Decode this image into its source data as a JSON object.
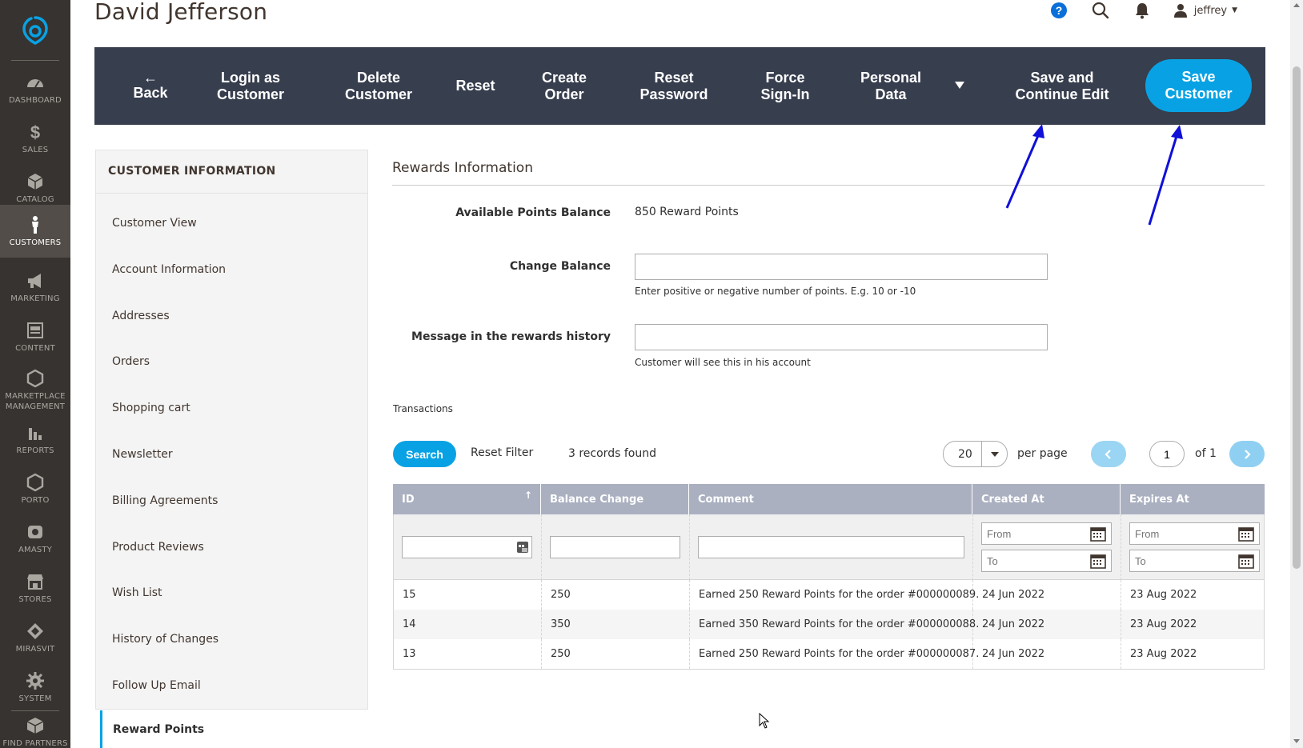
{
  "nav": {
    "items": [
      {
        "label": "DASHBOARD",
        "icon": "dashboard-icon"
      },
      {
        "label": "SALES",
        "icon": "dollar-icon"
      },
      {
        "label": "CATALOG",
        "icon": "cube-icon"
      },
      {
        "label": "CUSTOMERS",
        "icon": "person-icon",
        "active": true
      },
      {
        "label": "MARKETING",
        "icon": "megaphone-icon"
      },
      {
        "label": "CONTENT",
        "icon": "content-icon"
      },
      {
        "label": "MARKETPLACE MANAGEMENT",
        "icon": "hexagon-icon"
      },
      {
        "label": "REPORTS",
        "icon": "bar-chart-icon"
      },
      {
        "label": "PORTO",
        "icon": "hexagon-icon"
      },
      {
        "label": "AMASTY",
        "icon": "amasty-icon"
      },
      {
        "label": "STORES",
        "icon": "store-icon"
      },
      {
        "label": "MIRASVIT",
        "icon": "diamond-icon"
      },
      {
        "label": "SYSTEM",
        "icon": "gear-icon"
      },
      {
        "label": "FIND PARTNERS",
        "icon": "box-icon"
      }
    ]
  },
  "header": {
    "title": "David Jefferson",
    "user": "jeffrey"
  },
  "action_bar": {
    "back": "Back",
    "login_as_customer": "Login as\nCustomer",
    "delete_customer": "Delete\nCustomer",
    "reset": "Reset",
    "create_order": "Create\nOrder",
    "reset_password": "Reset\nPassword",
    "force_sign_in": "Force\nSign-In",
    "personal_data": "Personal\nData",
    "save_continue": "Save and\nContinue Edit",
    "save_customer": "Save\nCustomer"
  },
  "tabs": {
    "title": "CUSTOMER INFORMATION",
    "items": [
      "Customer View",
      "Account Information",
      "Addresses",
      "Orders",
      "Shopping cart",
      "Newsletter",
      "Billing Agreements",
      "Product Reviews",
      "Wish List",
      "History of Changes",
      "Follow Up Email"
    ],
    "active": "Reward Points"
  },
  "rewards": {
    "section_title": "Rewards Information",
    "available_label": "Available Points Balance",
    "available_value": "850 Reward Points",
    "change_label": "Change Balance",
    "change_value": "",
    "change_note": "Enter positive or negative number of points. E.g. 10 or -10",
    "message_label": "Message in the rewards history",
    "message_value": "",
    "message_note": "Customer will see this in his account"
  },
  "transactions": {
    "label": "Transactions",
    "search": "Search",
    "reset_filter": "Reset Filter",
    "records_found": "3 records found",
    "per_page_value": "20",
    "per_page_label": "per page",
    "page": "1",
    "of_pages": "of 1",
    "columns": [
      "ID",
      "Balance Change",
      "Comment",
      "Created At",
      "Expires At"
    ],
    "filter_from": "From",
    "filter_to": "To",
    "rows": [
      {
        "id": "15",
        "balance": "250",
        "comment": "Earned 250 Reward Points for the order #000000089.",
        "created": "24 Jun 2022",
        "expires": "23 Aug 2022"
      },
      {
        "id": "14",
        "balance": "350",
        "comment": "Earned 350 Reward Points for the order #000000088.",
        "created": "24 Jun 2022",
        "expires": "23 Aug 2022"
      },
      {
        "id": "13",
        "balance": "250",
        "comment": "Earned 250 Reward Points for the order #000000087.",
        "created": "24 Jun 2022",
        "expires": "23 Aug 2022"
      }
    ]
  },
  "colors": {
    "accent": "#08a2e4",
    "action_bar": "#373e4e",
    "nav_bg": "#373330",
    "annotation_arrow": "#1010d8"
  }
}
